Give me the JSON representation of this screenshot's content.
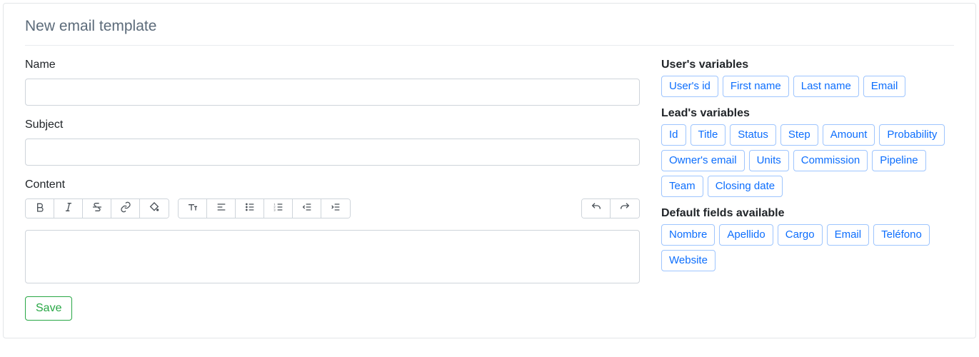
{
  "page": {
    "title": "New email template"
  },
  "form": {
    "name_label": "Name",
    "name_value": "",
    "subject_label": "Subject",
    "subject_value": "",
    "content_label": "Content",
    "content_value": "",
    "save_label": "Save"
  },
  "toolbar": {
    "bold": "Bold",
    "italic": "Italic",
    "strike": "Strikethrough",
    "link": "Link",
    "fill": "Background color",
    "fontsize": "Font size",
    "align": "Align",
    "ul": "Unordered list",
    "ol": "Ordered list",
    "outdent": "Decrease indent",
    "indent": "Increase indent",
    "undo": "Undo",
    "redo": "Redo"
  },
  "variables": {
    "user": {
      "heading": "User's variables",
      "items": [
        "User's id",
        "First name",
        "Last name",
        "Email"
      ]
    },
    "lead": {
      "heading": "Lead's variables",
      "items": [
        "Id",
        "Title",
        "Status",
        "Step",
        "Amount",
        "Probability",
        "Owner's email",
        "Units",
        "Commission",
        "Pipeline",
        "Team",
        "Closing date"
      ]
    },
    "default": {
      "heading": "Default fields available",
      "items": [
        "Nombre",
        "Apellido",
        "Cargo",
        "Email",
        "Teléfono",
        "Website"
      ]
    }
  }
}
